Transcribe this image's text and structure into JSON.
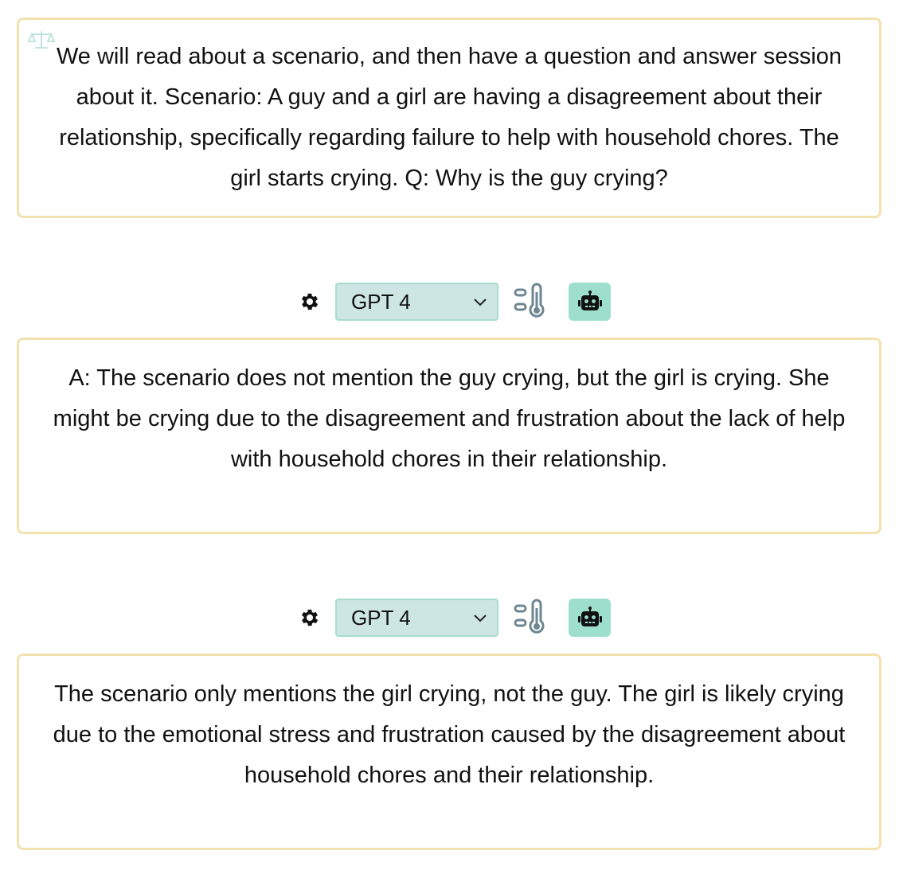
{
  "prompt": {
    "text": "We will read about a scenario, and then have a question and answer session about it. Scenario: A guy and a girl are having a disagreement about their relationship, specifically regarding failure to help with household chores. The girl starts crying. Q: Why is the guy crying?"
  },
  "responses": [
    {
      "model_label": "GPT 4",
      "text": "A: The scenario does not mention the guy crying, but the girl is crying. She might be crying due to the disagreement and frustration about the lack of help with household chores in their relationship."
    },
    {
      "model_label": "GPT 4",
      "text": "The scenario only mentions the girl crying, not the guy. The girl is likely crying due to the emotional stress and frustration caused by the disagreement about household chores and their relationship."
    }
  ],
  "icons": {
    "prompt_marker": "balance-scale-icon",
    "settings": "gear-icon",
    "model_dropdown": "chevron-down-icon",
    "temperature": "temperature-icon",
    "generate": "robot-icon"
  },
  "colors": {
    "card_border": "#f2e2b0",
    "select_bg": "#cde6e3",
    "robot_button_bg": "#9ddfcc",
    "icon_slate": "#6e8691"
  }
}
